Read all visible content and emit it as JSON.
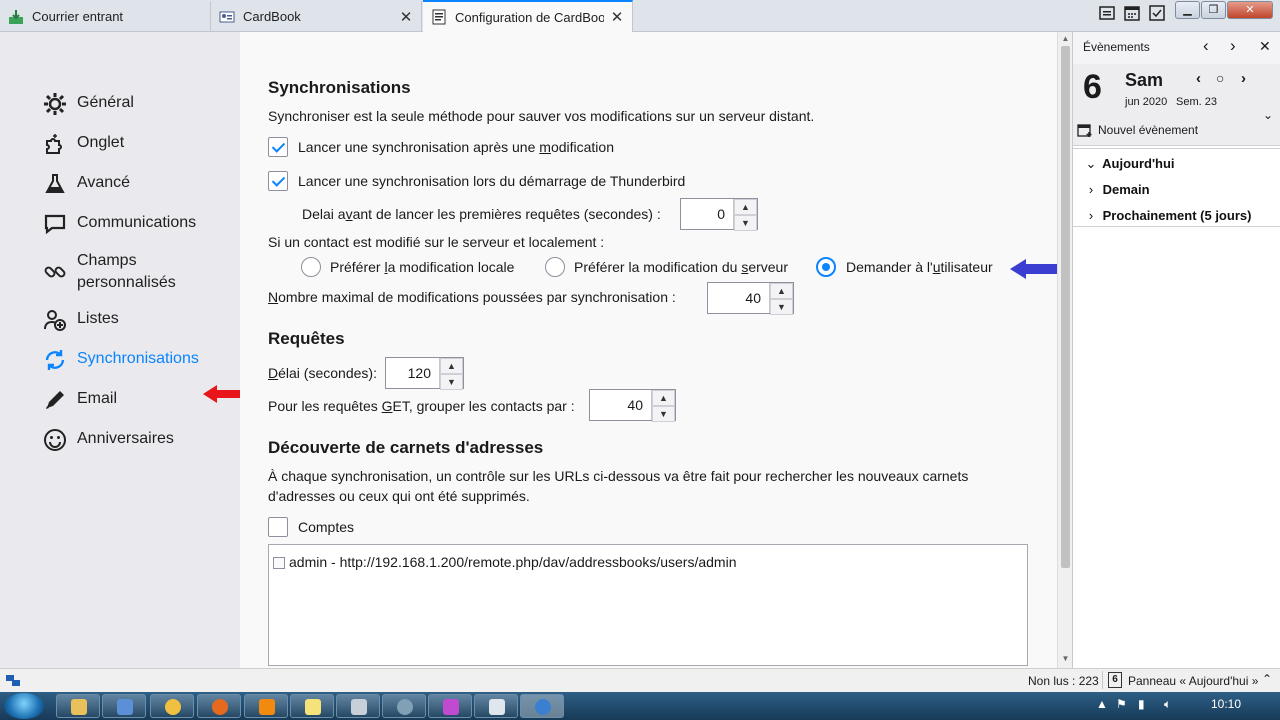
{
  "tabs": [
    {
      "label": "Courrier entrant"
    },
    {
      "label": "CardBook"
    },
    {
      "label": "Configuration de CardBook"
    }
  ],
  "nav": {
    "items": [
      {
        "label": "Général",
        "icon": "gear-icon"
      },
      {
        "label": "Onglet",
        "icon": "puzzle-icon"
      },
      {
        "label": "Avancé",
        "icon": "flask-icon"
      },
      {
        "label": "Communications",
        "icon": "chat-icon"
      },
      {
        "label": "Champs\npersonnalisés",
        "icon": "link-icon"
      },
      {
        "label": "Listes",
        "icon": "group-add-icon"
      },
      {
        "label": "Synchronisations",
        "icon": "sync-icon"
      },
      {
        "label": "Email",
        "icon": "pen-icon"
      },
      {
        "label": "Anniversaires",
        "icon": "smiley-icon"
      }
    ],
    "selected": "Synchronisations"
  },
  "sync": {
    "title": "Synchronisations",
    "desc": "Synchroniser est la seule méthode pour sauver vos modifications sur un serveur distant.",
    "cb1_pre": "Lancer une synchronisation après une ",
    "cb1_u": "m",
    "cb1_post": "odification",
    "cb1_checked": true,
    "cb2_label": "Lancer une synchronisation lors du démarrage de Thunderbird",
    "cb2_checked": true,
    "delay_pre": "Delai a",
    "delay_u": "v",
    "delay_post": "ant de lancer les premières requêtes (secondes) :",
    "delay_value": "0",
    "conflict_label": "Si un contact est modifié sur le serveur et localement :",
    "radio_local_pre": "Préférer ",
    "radio_local_u": "l",
    "radio_local_post": "a modification locale",
    "radio_server_pre": "Préférer la modification du ",
    "radio_server_u": "s",
    "radio_server_post": "erveur",
    "radio_ask_pre": "Demander à l'",
    "radio_ask_u": "u",
    "radio_ask_post": "tilisateur",
    "selected_radio": "Demander à l'utilisateur",
    "max_u": "N",
    "max_post": "ombre maximal de modifications poussées par synchronisation :",
    "max_value": "40"
  },
  "requests": {
    "title": "Requêtes",
    "delay_u": "D",
    "delay_post": "élai (secondes):",
    "delay_value": "120",
    "group_pre": "Pour les requêtes ",
    "group_u": "G",
    "group_post": "ET, grouper les contacts par :",
    "group_value": "40"
  },
  "discovery": {
    "title": "Découverte de carnets d'adresses",
    "desc1": "À chaque synchronisation, un contrôle sur les URLs ci-dessous va être fait pour rechercher les nouveaux carnets",
    "desc2": "d'adresses ou ceux qui ont été supprimés.",
    "accounts_label": "Comptes",
    "accounts_checked": false,
    "entries": [
      "admin - http://192.168.1.200/remote.php/dav/addressbooks/users/admin"
    ]
  },
  "events": {
    "title": "Évènements",
    "day_number": "6",
    "day_name": "Sam",
    "month_year": "jun 2020",
    "week": "Sem. 23",
    "new_event": "Nouvel évènement",
    "sections": [
      {
        "label": "Aujourd'hui",
        "expanded": true
      },
      {
        "label": "Demain",
        "expanded": false
      },
      {
        "label": "Prochainement (5 jours)",
        "expanded": false
      }
    ]
  },
  "status": {
    "unread": "Non lus : 223",
    "panel": "Panneau « Aujourd'hui »"
  },
  "taskbar": {
    "clock": "10:10"
  },
  "colors": {
    "accent": "#0a84ff",
    "red_arrow": "#e8151b",
    "blue_arrow": "#3a3fd1"
  }
}
